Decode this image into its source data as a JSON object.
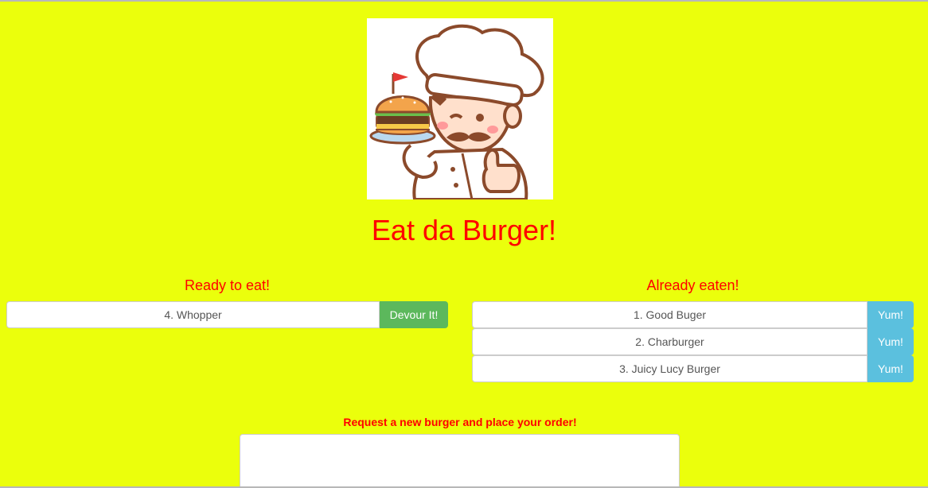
{
  "header": {
    "title": "Eat da Burger!"
  },
  "ready": {
    "heading": "Ready to eat!",
    "items": [
      {
        "label": "4. Whopper",
        "button": "Devour It!"
      }
    ]
  },
  "eaten": {
    "heading": "Already eaten!",
    "items": [
      {
        "label": "1. Good Buger",
        "button": "Yum!"
      },
      {
        "label": "2. Charburger",
        "button": "Yum!"
      },
      {
        "label": "3. Juicy Lucy Burger",
        "button": "Yum!"
      }
    ]
  },
  "order": {
    "label": "Request a new burger and place your order!",
    "value": "",
    "placeholder": ""
  },
  "colors": {
    "background": "#ebff0c",
    "accent_text": "#ff0000",
    "devour_button": "#5cb85c",
    "yum_button": "#5bc0de"
  },
  "icons": {
    "logo": "chef-holding-burger-illustration"
  }
}
